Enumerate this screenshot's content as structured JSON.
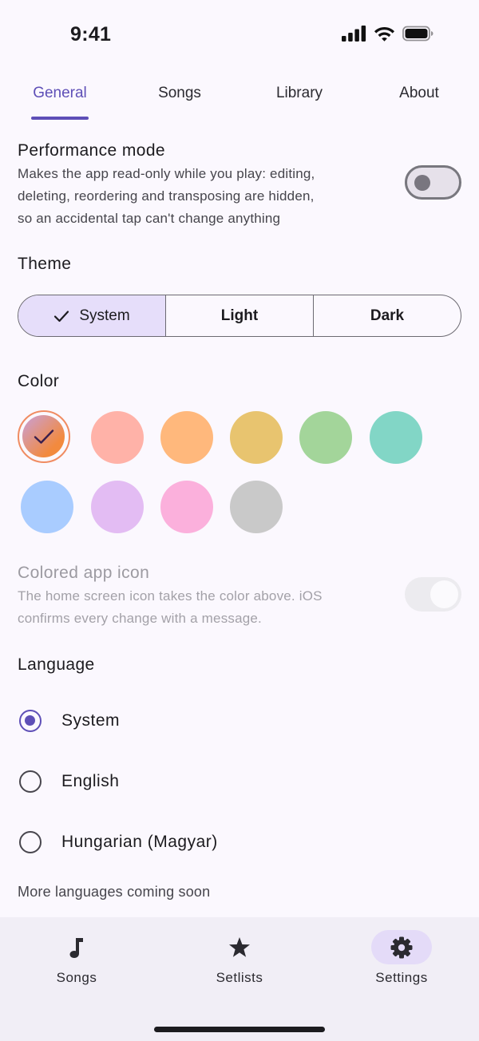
{
  "status_bar": {
    "time": "9:41"
  },
  "tabs": [
    {
      "label": "General",
      "active": true
    },
    {
      "label": "Songs",
      "active": false
    },
    {
      "label": "Library",
      "active": false
    },
    {
      "label": "About",
      "active": false
    }
  ],
  "performance_mode": {
    "title": "Performance mode",
    "description_lines": [
      "Makes the app read-only while you play: editing,",
      "deleting, reordering and transposing are hidden,",
      "so an accidental tap can't change anything"
    ],
    "enabled": false
  },
  "theme": {
    "title": "Theme",
    "options": [
      "System",
      "Light",
      "Dark"
    ],
    "selected": "System"
  },
  "color": {
    "title": "Color",
    "swatches": [
      {
        "name": "dynamic",
        "hex": "#f28a3e",
        "selected": true
      },
      {
        "name": "red",
        "hex": "#ffb2a8"
      },
      {
        "name": "orange",
        "hex": "#ffb87c"
      },
      {
        "name": "yellow",
        "hex": "#e8c46f"
      },
      {
        "name": "green",
        "hex": "#a3d59a"
      },
      {
        "name": "teal",
        "hex": "#82d6c6"
      },
      {
        "name": "blue",
        "hex": "#a9ccff"
      },
      {
        "name": "purple",
        "hex": "#e3bcf3"
      },
      {
        "name": "pink",
        "hex": "#fbb0dc"
      },
      {
        "name": "gray",
        "hex": "#c9c9c9"
      }
    ]
  },
  "colored_app_icon": {
    "title": "Colored app icon",
    "description_lines": [
      "The home screen icon takes the color above. iOS",
      "confirms every change with a message."
    ],
    "enabled": true,
    "disabled": true
  },
  "language": {
    "title": "Language",
    "options": [
      "System",
      "English",
      "Hungarian (Magyar)"
    ],
    "selected": "System",
    "footnote": "More languages coming soon"
  },
  "bottom_nav": [
    {
      "label": "Songs",
      "icon": "music-note-icon",
      "active": false
    },
    {
      "label": "Setlists",
      "icon": "star-icon",
      "active": false
    },
    {
      "label": "Settings",
      "icon": "gear-icon",
      "active": true
    }
  ],
  "colors": {
    "accent": "#5e4fb7",
    "background": "#fbf8fe",
    "nav_background": "#f1eef6"
  }
}
